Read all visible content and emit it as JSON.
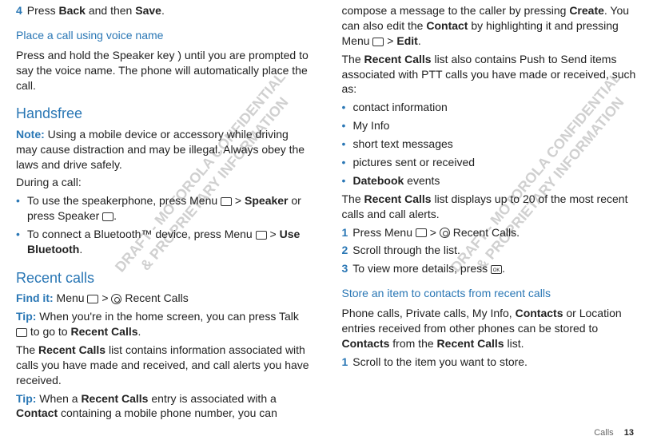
{
  "left": {
    "step4": {
      "num": "4",
      "pre": "Press ",
      "b1": "Back",
      "mid": " and then ",
      "b2": "Save",
      "end": "."
    },
    "h_voice": "Place a call using voice name",
    "voice_para": "Press and hold the Speaker key ) until you are prompted to say the voice name. The phone will automatically place the call.",
    "h_handsfree": "Handsfree",
    "note_label": "Note:",
    "note_text": " Using a mobile device or accessory while driving may cause distraction and may be illegal. Always obey the laws and drive safely.",
    "during": "During a call:",
    "b_list": {
      "i1_a": "To use the speakerphone, press Menu ",
      "i1_b": " > ",
      "i1_bold": "Speaker",
      "i1_c": " or press Speaker ",
      "i1_d": ".",
      "i2_a": "To connect a Bluetooth™ device, press Menu ",
      "i2_b": " > ",
      "i2_bold": "Use Bluetooth",
      "i2_c": "."
    },
    "h_recent": "Recent calls",
    "findit_label": "Find it:",
    "findit_a": " Menu ",
    "findit_b": " > ",
    "findit_c": " Recent Calls",
    "tip_label": "Tip:",
    "tip1_a": " When you're in the home screen, you can press Talk ",
    "tip1_b": " to go to ",
    "tip1_bold": "Recent Calls",
    "tip1_c": ".",
    "recent_para_a": "The ",
    "recent_para_bold": "Recent Calls",
    "recent_para_b": " list contains information associated with calls you have made and received, and call alerts you have received.",
    "tip2_a": " When a ",
    "tip2_bold1": "Recent Calls",
    "tip2_b": " entry is associated with a ",
    "tip2_bold2": "Contact",
    "tip2_c": " containing a mobile phone number, you can"
  },
  "right": {
    "top_a": "compose a message to the caller by pressing ",
    "top_bold1": "Create",
    "top_b": ". You can also edit the ",
    "top_bold2": "Contact",
    "top_c": " by highlighting it and pressing Menu ",
    "top_d": " > ",
    "top_bold3": "Edit",
    "top_e": ".",
    "para2_a": "The ",
    "para2_bold": "Recent Calls",
    "para2_b": " list also contains Push to Send items associated with PTT calls you have made or received, such as:",
    "bl": {
      "i1": "contact information",
      "i2": "My Info",
      "i3": "short text messages",
      "i4": "pictures sent or received",
      "i5_bold": "Datebook",
      "i5_b": " events"
    },
    "para3_a": "The ",
    "para3_bold": "Recent Calls",
    "para3_b": " list displays up to 20 of the most recent calls and call alerts.",
    "s1": {
      "num": "1",
      "a": "Press Menu ",
      "b": " > ",
      "c": " Recent Calls."
    },
    "s2": {
      "num": "2",
      "t": "Scroll through the list."
    },
    "s3": {
      "num": "3",
      "a": "To view more details, press ",
      "b": "."
    },
    "h_store": "Store an item to contacts from recent calls",
    "store_a": "Phone calls, Private calls, My Info, ",
    "store_bold1": "Contacts",
    "store_b": " or Location entries received from other phones can be stored to ",
    "store_bold2": "Contacts",
    "store_c": " from the ",
    "store_bold3": "Recent Calls",
    "store_d": " list.",
    "s_store1": {
      "num": "1",
      "t": "Scroll to the item you want to store."
    }
  },
  "watermarks": {
    "wm": "DRAFT - MOTOROLA CONFIDENTIAL\n& PROPRIETARY INFORMATION"
  },
  "footer": {
    "label": "Calls",
    "page": "13"
  }
}
